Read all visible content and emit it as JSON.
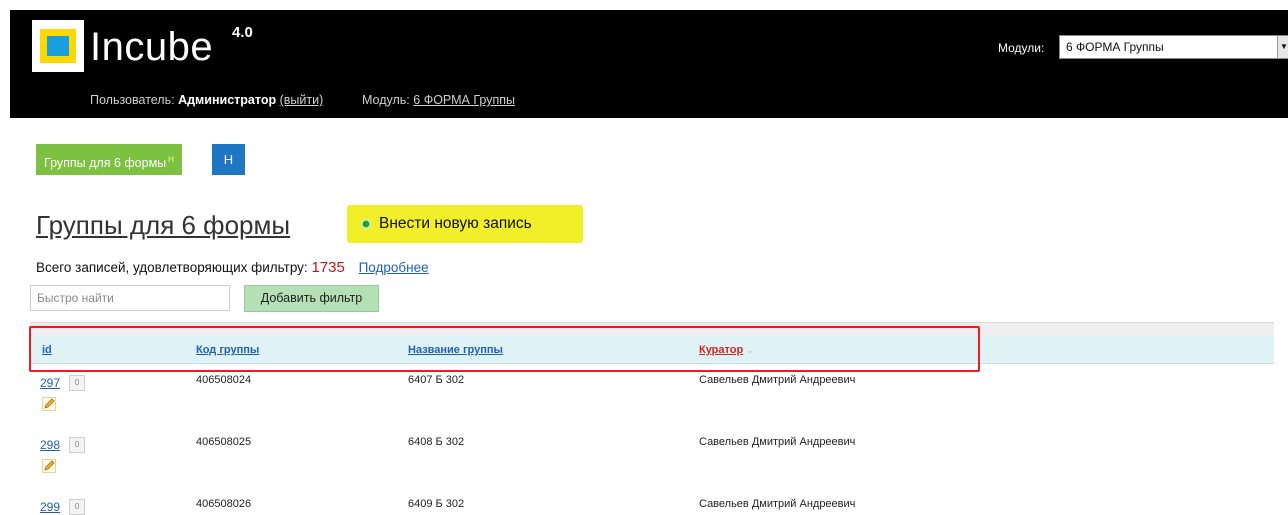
{
  "header": {
    "brand": "Incube",
    "version": "4.0",
    "user_prefix": "Пользователь:",
    "user_name": "Администратор",
    "logout": "(выйти)",
    "module_prefix": "Модуль:",
    "module_link": "6 ФОРМА Группы",
    "modules_label": "Модули:",
    "modules_selected": "6 ФОРМА Группы"
  },
  "tabs": {
    "groups_label": "Группы для 6 формы",
    "groups_badge": "Н",
    "new_label": "Н"
  },
  "main": {
    "title": "Группы для 6 формы",
    "add_button": "Внести новую запись",
    "summary_text": "Всего записей, удовлетворяющих фильтру:",
    "summary_count": "1735",
    "details_link": "Подробнее",
    "search_placeholder": "Быстро найти",
    "add_filter": "Добавить фильтр"
  },
  "table": {
    "columns": [
      "id",
      "Код группы",
      "Название группы",
      "Куратор"
    ],
    "sorted_column": "Куратор",
    "rows": [
      {
        "id": "297",
        "badge": "0",
        "code": "406508024",
        "name": "6407 Б 302",
        "curator": "Савельев Дмитрий Андреевич"
      },
      {
        "id": "298",
        "badge": "0",
        "code": "406508025",
        "name": "6408 Б 302",
        "curator": "Савельев Дмитрий Андреевич"
      },
      {
        "id": "299",
        "badge": "0",
        "code": "406508026",
        "name": "6409 Б 302",
        "curator": "Савельев Дмитрий Андреевич"
      }
    ]
  },
  "colors": {
    "header_bg": "#000000",
    "tab_green": "#7cc142",
    "tab_blue": "#1f76c2",
    "add_button": "#f0ef2a",
    "table_header": "#dff2f5",
    "highlight": "#ee1c1c",
    "count": "#c21616"
  },
  "icons": {
    "add": "green-circle-icon",
    "edit": "pencil-icon",
    "sort": "caret-down-icon",
    "select": "dropdown-arrow-icon"
  }
}
